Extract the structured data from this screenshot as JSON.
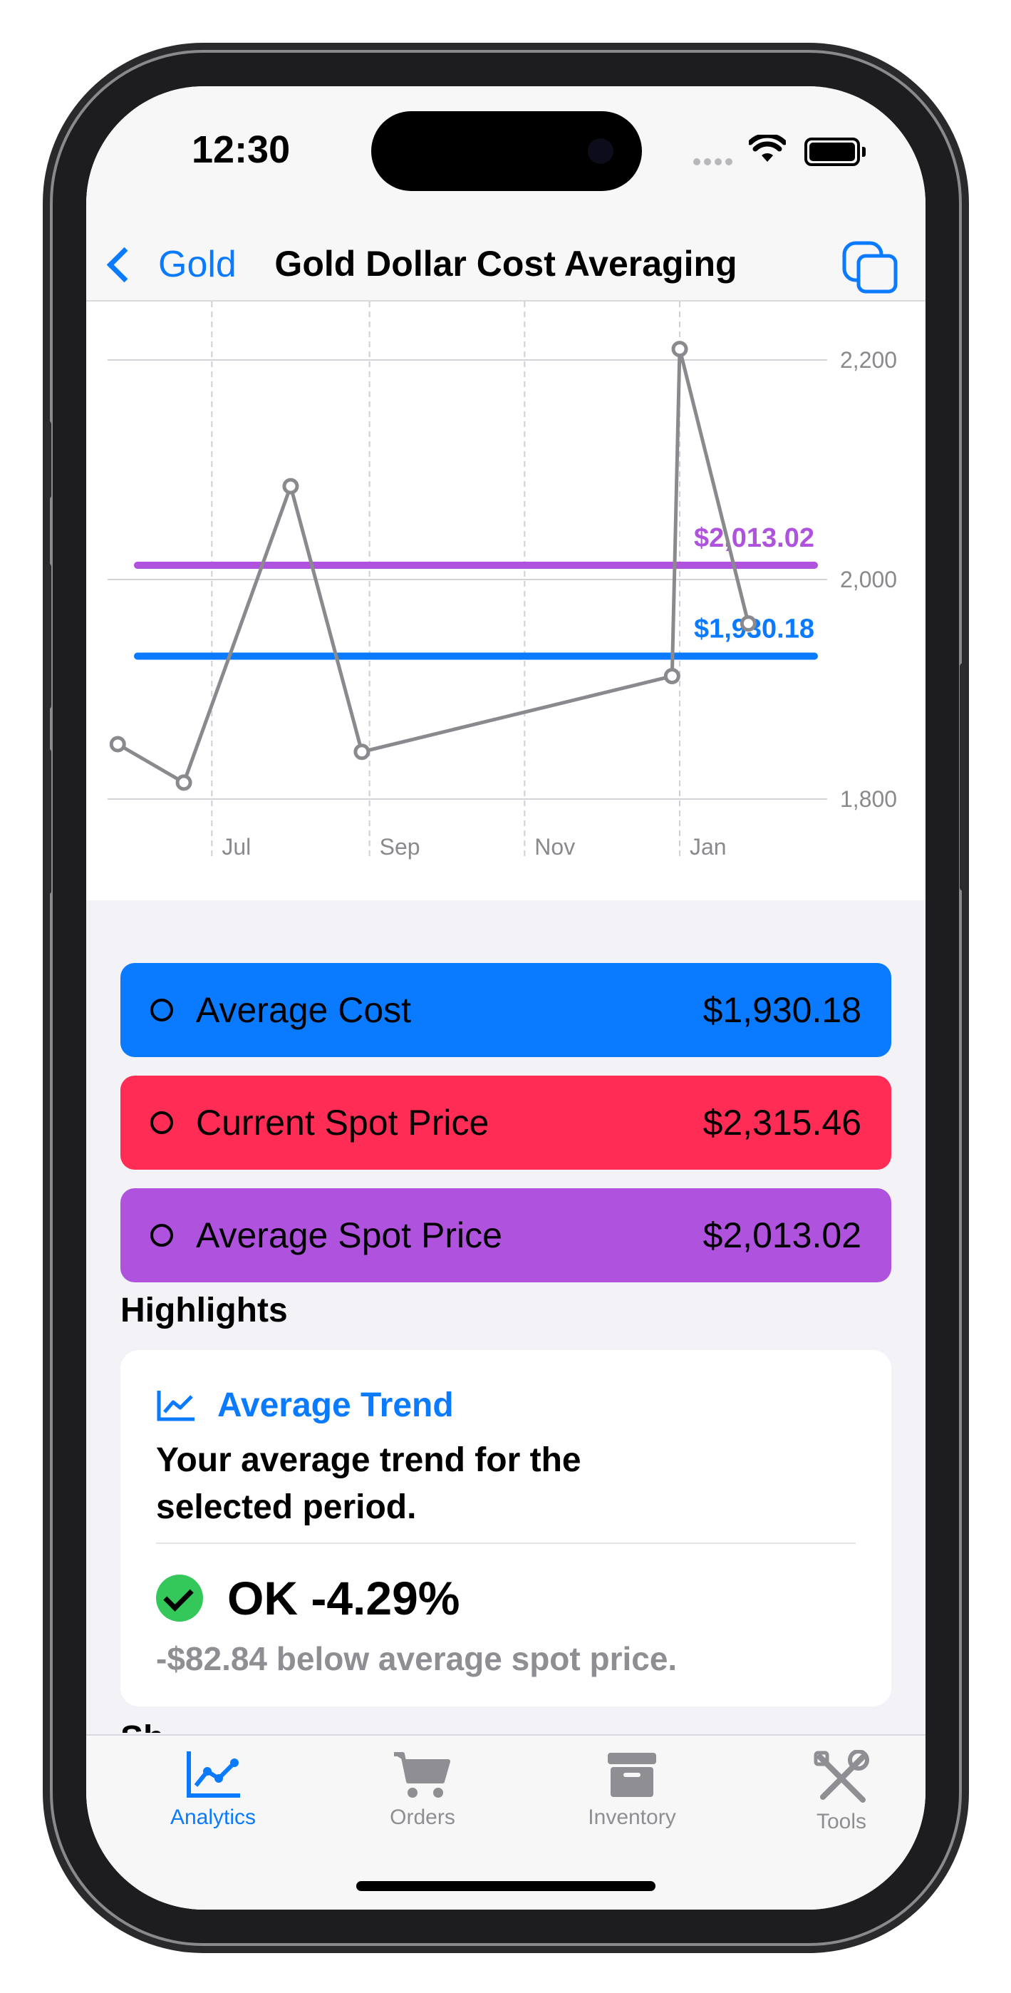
{
  "status_bar": {
    "time": "12:30"
  },
  "nav": {
    "back_label": "Gold",
    "title": "Gold Dollar Cost Averaging",
    "action_icon": "copy-square-icon"
  },
  "chart_data": {
    "type": "line",
    "series": [
      {
        "x": [
          "2023-05-25",
          "2023-06-20",
          "2023-08-01",
          "2023-08-29",
          "2023-12-29",
          "2024-01-01",
          "2024-01-28"
        ],
        "y": [
          1850,
          1815,
          2085,
          1843,
          1912,
          2210,
          1960
        ]
      }
    ],
    "reference_lines": [
      {
        "label": "$2,013.02",
        "value": 2013.02,
        "color": "#af52de"
      },
      {
        "label": "$1,930.18",
        "value": 1930.18,
        "color": "#0a7aff"
      }
    ],
    "x_ticks": [
      "Jul",
      "Sep",
      "Nov",
      "Jan"
    ],
    "y_ticks": [
      "2,200",
      "2,000",
      "1,800"
    ],
    "ylim": [
      1800,
      2250
    ],
    "grid": true
  },
  "summary": [
    {
      "label": "Average Cost",
      "value": "$1,930.18",
      "color": "#0a7aff"
    },
    {
      "label": "Current Spot Price",
      "value": "$2,315.46",
      "color": "#ff2d55"
    },
    {
      "label": "Average Spot Price",
      "value": "$2,013.02",
      "color": "#af52de"
    }
  ],
  "highlights": {
    "title": "Highlights",
    "card": {
      "heading": "Average Trend",
      "description": "Your average trend for the selected period.",
      "status": "OK -4.29%",
      "subtext": "-$82.84 below average spot price."
    },
    "next_section_peek": "Sh"
  },
  "tabs": [
    {
      "label": "Analytics",
      "icon": "chart-icon",
      "active": true
    },
    {
      "label": "Orders",
      "icon": "cart-icon",
      "active": false
    },
    {
      "label": "Inventory",
      "icon": "archive-box-icon",
      "active": false
    },
    {
      "label": "Tools",
      "icon": "tools-icon",
      "active": false
    }
  ]
}
